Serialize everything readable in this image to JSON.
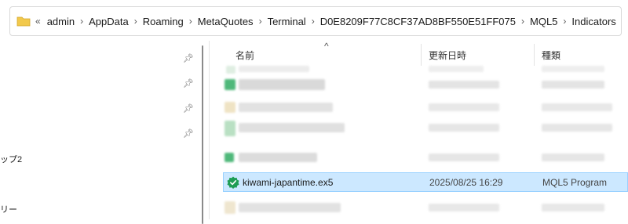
{
  "address_bar": {
    "overflow_label": "«",
    "breadcrumbs": [
      "admin",
      "AppData",
      "Roaming",
      "MetaQuotes",
      "Terminal",
      "D0E8209F77C8CF37AD8BF550E51FF075",
      "MQL5",
      "Indicators"
    ],
    "separator": "›"
  },
  "nav": {
    "items": [
      {
        "label": "ップ2"
      },
      {
        "label": "リー"
      }
    ]
  },
  "columns": {
    "name": "名前",
    "date": "更新日時",
    "type": "種類"
  },
  "selected_file": {
    "name": "kiwami-japantime.ex5",
    "date": "2025/08/25 16:29",
    "type": "MQL5 Program",
    "icon": "verified-shield-icon"
  },
  "colors": {
    "selection_bg": "#cce8ff",
    "selection_border": "#99d1ff",
    "folder": "#f2c94c",
    "verified": "#1f9d55"
  }
}
